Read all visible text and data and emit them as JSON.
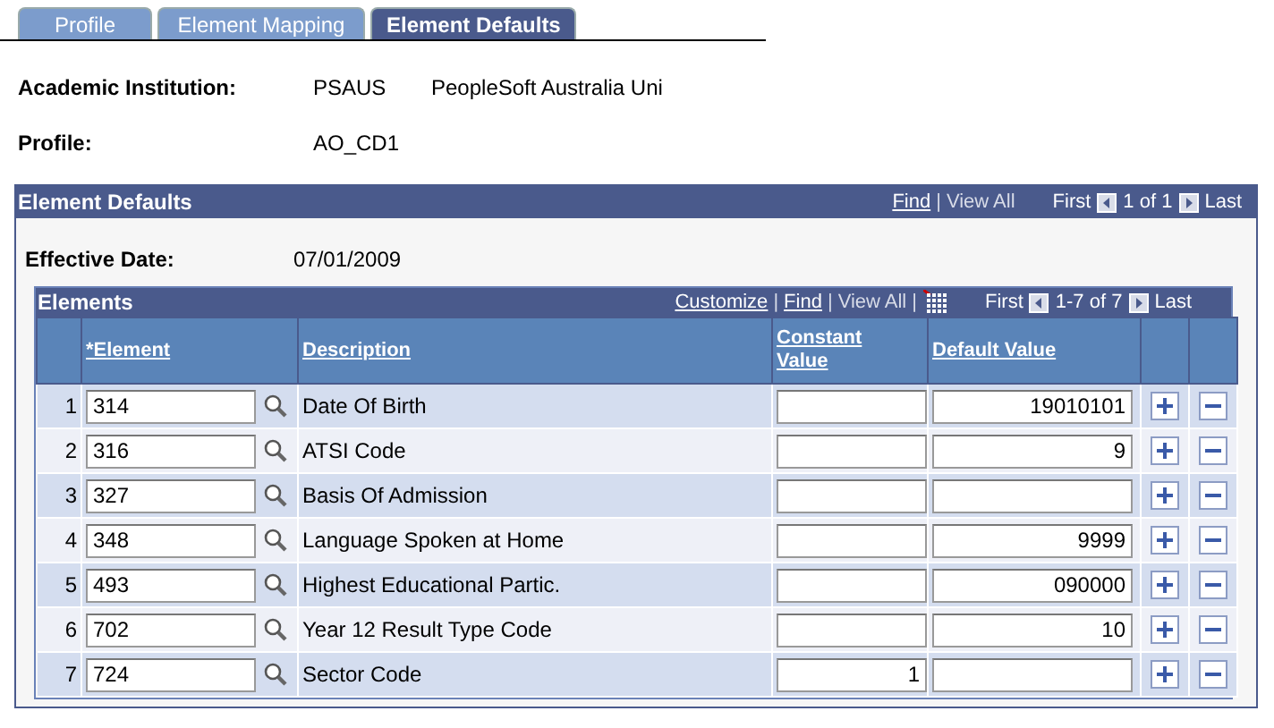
{
  "tabs": [
    {
      "label": "Profile",
      "selected": false
    },
    {
      "label": "Element Mapping",
      "selected": false
    },
    {
      "label": "Element Defaults",
      "selected": true
    }
  ],
  "fields": [
    {
      "label": "Academic Institution:",
      "value": "PSAUS",
      "description": "PeopleSoft Australia Uni"
    },
    {
      "label": "Profile:",
      "value": "AO_CD1"
    }
  ],
  "panel": {
    "title": "Element Defaults",
    "links": [
      {
        "label": "Find",
        "disabled": false
      },
      {
        "label": "View All",
        "disabled": true
      }
    ],
    "separator": "|",
    "first": "First",
    "count": "1 of 1",
    "last": "Last",
    "effective_date": {
      "label": "Effective Date:",
      "value": "07/01/2009"
    },
    "grid": {
      "title": "Elements",
      "links": [
        {
          "label": "Customize",
          "disabled": false
        },
        {
          "label": "Find",
          "disabled": false
        },
        {
          "label": "View All",
          "disabled": true
        }
      ],
      "trailing_separator": true,
      "first": "First",
      "count": "1-7 of 7",
      "last": "Last",
      "columns": [
        "*Element",
        "Description",
        "Constant Value",
        "Default Value"
      ],
      "rows": [
        {
          "num": "1",
          "element": "314",
          "description": "Date Of Birth",
          "constant": "",
          "default": "19010101"
        },
        {
          "num": "2",
          "element": "316",
          "description": "ATSI Code",
          "constant": "",
          "default": "9"
        },
        {
          "num": "3",
          "element": "327",
          "description": "Basis Of Admission",
          "constant": "",
          "default": ""
        },
        {
          "num": "4",
          "element": "348",
          "description": "Language Spoken at Home",
          "constant": "",
          "default": "9999"
        },
        {
          "num": "5",
          "element": "493",
          "description": "Highest Educational Partic.",
          "constant": "",
          "default": "090000"
        },
        {
          "num": "6",
          "element": "702",
          "description": "Year 12 Result Type Code",
          "constant": "",
          "default": "10"
        },
        {
          "num": "7",
          "element": "724",
          "description": "Sector Code",
          "constant": "1",
          "default": ""
        }
      ]
    }
  }
}
